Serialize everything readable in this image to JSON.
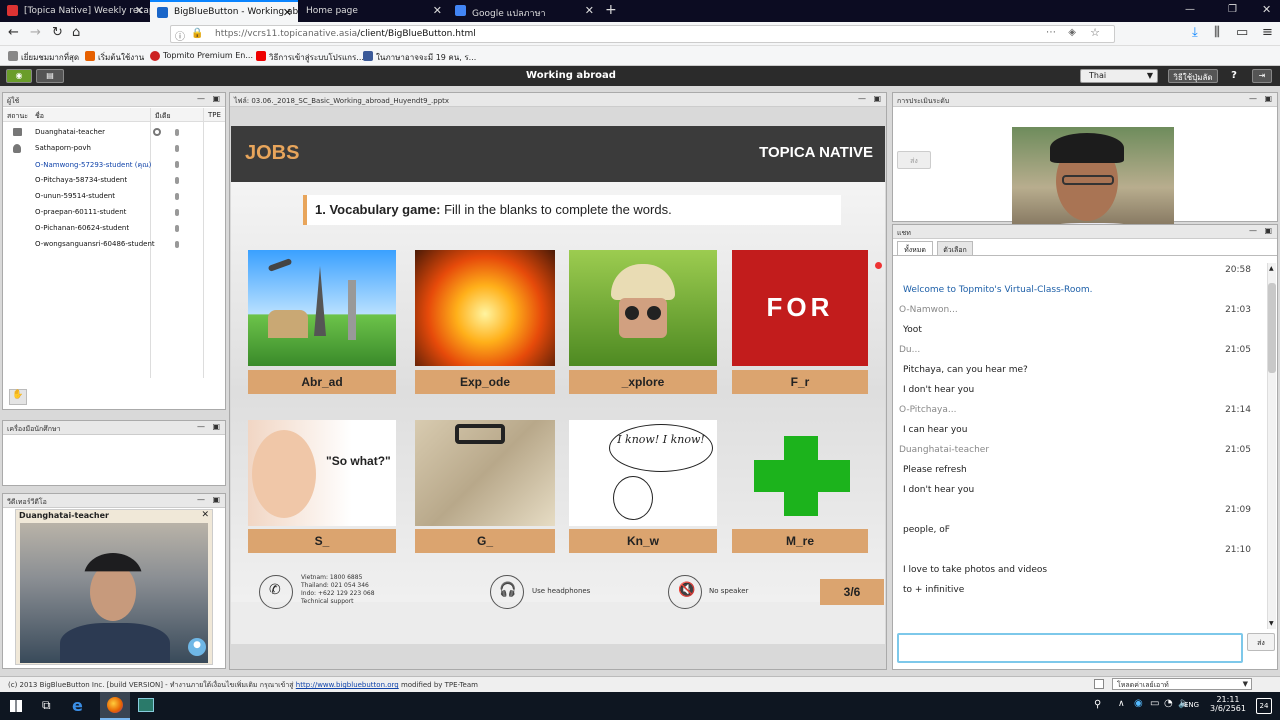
{
  "browser": {
    "tabs": [
      {
        "title": "[Topica Native] Weekly recap",
        "active": false
      },
      {
        "title": "BigBlueButton - Working abroad",
        "active": true
      },
      {
        "title": "Home page",
        "active": false
      },
      {
        "title": "Google แปลภาษา",
        "active": false
      }
    ],
    "url_host": "https://vcrs11.topicanative.asia",
    "url_path": "/client/BigBlueButton.html",
    "bookmarks": [
      "เยี่ยมชมมากที่สุด",
      "เริ่มต้นใช้งาน",
      "Topmito Premium En...",
      "วิธีการเข้าสู่ระบบโปรแกร...",
      "ในภาษาอาจจะมี 19 คน, ร..."
    ]
  },
  "app": {
    "title": "Working abroad",
    "language": "Thai",
    "help_button": "วิธีใช้ปุ่มลัด",
    "help_icon": "?"
  },
  "users_panel": {
    "title": "ผู้ใช้",
    "col_status": "สถานะ",
    "col_name": "ชื่อ",
    "col_media": "มีเดีย",
    "col_tpe": "TPE",
    "users": [
      {
        "name": "Duanghatai-teacher",
        "highlight": false
      },
      {
        "name": "Sathaporn-povh",
        "highlight": false
      },
      {
        "name": "O-Namwong-57293-student (คุณ)",
        "highlight": true
      },
      {
        "name": "O-Pitchaya-58734-student",
        "highlight": false
      },
      {
        "name": "O-unun-59514-student",
        "highlight": false
      },
      {
        "name": "O-praepan-60111-student",
        "highlight": false
      },
      {
        "name": "O-Pichanan-60624-student",
        "highlight": false
      },
      {
        "name": "O-wongsanguansri-60486-student",
        "highlight": false
      }
    ]
  },
  "tools_panel": {
    "title": "เครื่องมือนักศึกษา"
  },
  "video_panel": {
    "title": "วีดีเทอร์วีดีโอ",
    "user": "Duanghatai-teacher"
  },
  "presentation": {
    "file": "ไฟล์: 03.06._2018_SC_Basic_Working_abroad_Huyendt9_.pptx",
    "header": "JOBS",
    "brand": "TOPICA NATIVE",
    "game_bold": "1. Vocabulary game:",
    "game_text": " Fill in the blanks to complete the words.",
    "cards": [
      "Abr_ad",
      "Exp_ode",
      "_xplore",
      "F_r",
      "S_",
      "G_",
      "Kn_w",
      "M_re"
    ],
    "for_text": "FOR",
    "so_what": "\"So what?\"",
    "i_know": "I know! I know!",
    "support": [
      "Vietnam: 1800 6885",
      "Thailand: 021 054 346",
      "Indo: +622 129 223 068",
      "Technical support"
    ],
    "headphones": "Use headphones",
    "no_speaker": "No speaker",
    "page": "3/6"
  },
  "assessment_panel": {
    "title": "การประเมินระดับ",
    "send": "ส่ง"
  },
  "chat": {
    "title": "แชท",
    "tab_all": "ทั้งหมด",
    "tab_options": "ตัวเลือก",
    "messages": [
      {
        "type": "time",
        "text": "20:58"
      },
      {
        "type": "system",
        "text": "Welcome to Topmito's Virtual-Class-Room."
      },
      {
        "type": "name",
        "text": "O-Namwon...",
        "time": "21:03"
      },
      {
        "type": "msg",
        "text": "Yoot"
      },
      {
        "type": "name",
        "text": "Du...",
        "time": "21:05"
      },
      {
        "type": "msg",
        "text": "Pitchaya, can you hear me?"
      },
      {
        "type": "msg",
        "text": "I don't hear you"
      },
      {
        "type": "name",
        "text": "O-Pitchaya...",
        "time": "21:14"
      },
      {
        "type": "msg",
        "text": "I can hear you"
      },
      {
        "type": "name",
        "text": "Duanghatai-teacher",
        "time": "21:05"
      },
      {
        "type": "msg",
        "text": "Please refresh"
      },
      {
        "type": "msg",
        "text": "I don't hear you"
      },
      {
        "type": "time",
        "text": "21:09"
      },
      {
        "type": "msg",
        "text": "people, oF"
      },
      {
        "type": "time",
        "text": "21:10"
      },
      {
        "type": "msg",
        "text": "I love to take photos and videos"
      },
      {
        "type": "msg",
        "text": "to + infinitive"
      }
    ],
    "send_label": "ส่ง"
  },
  "statusbar": {
    "text": "(c) 2013 BigBlueButton Inc. [build VERSION] - ทำงานภายใต้เงื่อนไขเพิ่มเติม กรุณาเข้าสู่ ",
    "link": "http://www.bigbluebutton.org",
    "suffix": " modified by TPE-Team",
    "layout_select": "โหลดค่าเลย์เอาท์"
  },
  "taskbar": {
    "lang": "ENG",
    "time": "21:11",
    "date": "3/6/2561",
    "notif": "24"
  }
}
